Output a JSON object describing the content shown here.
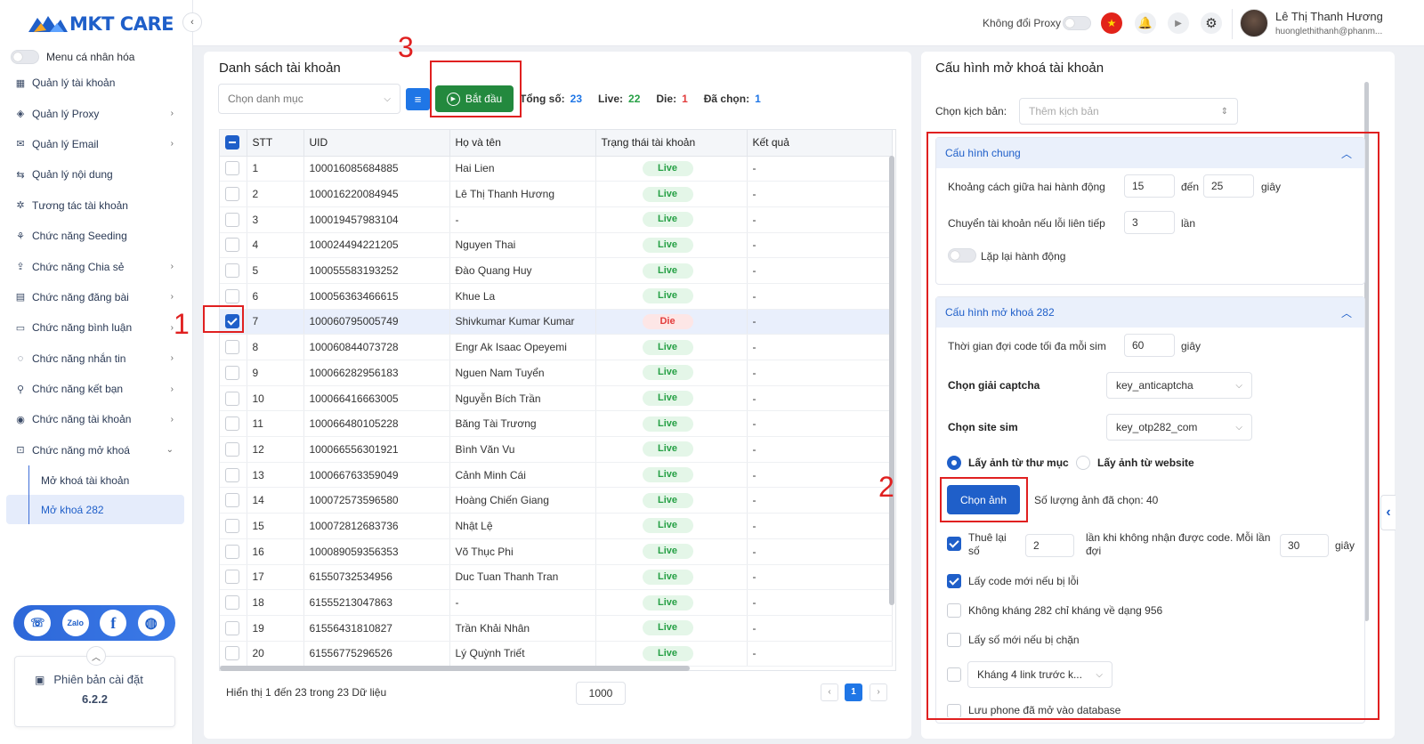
{
  "app": {
    "logo_text": "MKT CARE",
    "accent": "#1f5fc9",
    "live_color": "#26a045",
    "die_color": "#e23c3c"
  },
  "sidebar": {
    "toggle_label": "Menu cá nhân hóa",
    "items": [
      {
        "label": "Quản lý tài khoản",
        "icon": "grid-icon",
        "has_children": false
      },
      {
        "label": "Quản lý Proxy",
        "icon": "layers-icon",
        "has_children": true
      },
      {
        "label": "Quản lý Email",
        "icon": "mail-icon",
        "has_children": true
      },
      {
        "label": "Quản lý nội dung",
        "icon": "content-icon",
        "has_children": false
      },
      {
        "label": "Tương tác tài khoản",
        "icon": "interact-icon",
        "has_children": false
      },
      {
        "label": "Chức năng Seeding",
        "icon": "seeding-icon",
        "has_children": false
      },
      {
        "label": "Chức năng Chia sẻ",
        "icon": "share-icon",
        "has_children": true
      },
      {
        "label": "Chức năng đăng bài",
        "icon": "post-icon",
        "has_children": true
      },
      {
        "label": "Chức năng bình luận",
        "icon": "comment-icon",
        "has_children": true
      },
      {
        "label": "Chức năng nhắn tin",
        "icon": "message-icon",
        "has_children": true
      },
      {
        "label": "Chức năng kết bạn",
        "icon": "add-friend-icon",
        "has_children": true
      },
      {
        "label": "Chức năng tài khoản",
        "icon": "account-icon",
        "has_children": true
      },
      {
        "label": "Chức năng mở khoá",
        "icon": "unlock-icon",
        "has_children": true,
        "expanded": true
      }
    ],
    "subitems": [
      {
        "label": "Mở khoá tài khoản",
        "active": false
      },
      {
        "label": "Mở khoá 282",
        "active": true
      }
    ],
    "version_label": "Phiên bản cài đặt",
    "version": "6.2.2"
  },
  "topbar": {
    "proxy_label": "Không đổi Proxy",
    "user_name": "Lê Thị Thanh Hương",
    "user_email": "huonglethithanh@phanm..."
  },
  "accounts": {
    "title": "Danh sách tài khoản",
    "category_placeholder": "Chọn danh mục",
    "start_label": "Bắt đầu",
    "stats": {
      "total_label": "Tổng số:",
      "total": "23",
      "live_label": "Live:",
      "live": "22",
      "die_label": "Die:",
      "die": "1",
      "selected_label": "Đã chọn:",
      "selected": "1"
    },
    "columns": [
      "STT",
      "UID",
      "Họ và tên",
      "Trạng thái tài khoản",
      "Kết quả"
    ],
    "rows": [
      {
        "stt": "1",
        "uid": "100016085684885",
        "name": "Hai Lien",
        "status": "Live",
        "result": "-",
        "checked": false
      },
      {
        "stt": "2",
        "uid": "100016220084945",
        "name": "Lê Thị Thanh Hương",
        "status": "Live",
        "result": "-",
        "checked": false
      },
      {
        "stt": "3",
        "uid": "100019457983104",
        "name": "-",
        "status": "Live",
        "result": "-",
        "checked": false
      },
      {
        "stt": "4",
        "uid": "100024494221205",
        "name": "Nguyen Thai",
        "status": "Live",
        "result": "-",
        "checked": false
      },
      {
        "stt": "5",
        "uid": "100055583193252",
        "name": "Đào Quang Huy",
        "status": "Live",
        "result": "-",
        "checked": false
      },
      {
        "stt": "6",
        "uid": "100056363466615",
        "name": "Khue La",
        "status": "Live",
        "result": "-",
        "checked": false
      },
      {
        "stt": "7",
        "uid": "100060795005749",
        "name": "Shivkumar Kumar Kumar",
        "status": "Die",
        "result": "-",
        "checked": true
      },
      {
        "stt": "8",
        "uid": "100060844073728",
        "name": "Engr Ak Isaac Opeyemi",
        "status": "Live",
        "result": "-",
        "checked": false
      },
      {
        "stt": "9",
        "uid": "100066282956183",
        "name": "Nguen Nam Tuyển",
        "status": "Live",
        "result": "-",
        "checked": false
      },
      {
        "stt": "10",
        "uid": "100066416663005",
        "name": "Nguyễn Bích Trần",
        "status": "Live",
        "result": "-",
        "checked": false
      },
      {
        "stt": "11",
        "uid": "100066480105228",
        "name": "Băng Tài Trương",
        "status": "Live",
        "result": "-",
        "checked": false
      },
      {
        "stt": "12",
        "uid": "100066556301921",
        "name": "Bình Văn Vu",
        "status": "Live",
        "result": "-",
        "checked": false
      },
      {
        "stt": "13",
        "uid": "100066763359049",
        "name": "Cảnh Minh Cái",
        "status": "Live",
        "result": "-",
        "checked": false
      },
      {
        "stt": "14",
        "uid": "100072573596580",
        "name": "Hoàng Chiến Giang",
        "status": "Live",
        "result": "-",
        "checked": false
      },
      {
        "stt": "15",
        "uid": "100072812683736",
        "name": "Nhật Lệ",
        "status": "Live",
        "result": "-",
        "checked": false
      },
      {
        "stt": "16",
        "uid": "100089059356353",
        "name": "Võ Thục Phi",
        "status": "Live",
        "result": "-",
        "checked": false
      },
      {
        "stt": "17",
        "uid": "61550732534956",
        "name": "Duc Tuan Thanh Tran",
        "status": "Live",
        "result": "-",
        "checked": false
      },
      {
        "stt": "18",
        "uid": "61555213047863",
        "name": "-",
        "status": "Live",
        "result": "-",
        "checked": false
      },
      {
        "stt": "19",
        "uid": "61556431810827",
        "name": "Trần Khải Nhân",
        "status": "Live",
        "result": "-",
        "checked": false
      },
      {
        "stt": "20",
        "uid": "61556775296526",
        "name": "Lý Quỳnh Triết",
        "status": "Live",
        "result": "-",
        "checked": false
      }
    ],
    "footer_info": "Hiển thị 1 đến 23 trong 23 Dữ liệu",
    "page_size": "1000",
    "current_page": "1"
  },
  "config": {
    "title": "Cấu hình mở khoá tài khoản",
    "script_label": "Chọn kịch bản:",
    "script_placeholder": "Thêm kịch bản",
    "general": {
      "title": "Cấu hình chung",
      "delay_label": "Khoảng cách giữa hai hành động",
      "delay_from": "15",
      "to_label": "đến",
      "delay_to": "25",
      "sec_label": "giây",
      "switch_label": "Chuyển tài khoản nếu lỗi liên tiếp",
      "switch_value": "3",
      "times_label": "lần",
      "repeat_label": "Lặp lại hành động"
    },
    "unlock": {
      "title": "Cấu hình mở khoá 282",
      "wait_label": "Thời gian đợi code tối đa mỗi sim",
      "wait_value": "60",
      "wait_unit": "giây",
      "captcha_label": "Chọn giải captcha",
      "captcha_value": "key_anticaptcha",
      "sim_label": "Chọn site sim",
      "sim_value": "key_otp282_com",
      "radio_folder": "Lấy ảnh từ thư mục",
      "radio_web": "Lấy ảnh từ website",
      "choose_btn": "Chọn ảnh",
      "photo_count": "Số lượng ảnh đã chọn: 40",
      "rent_label": "Thuê lại số",
      "rent_value": "2",
      "rent_text": "lần khi không nhận được code. Mỗi lần đợi",
      "rent_wait": "30",
      "rent_unit": "giây",
      "new_code_label": "Lấy code mới nếu bị lỗi",
      "no_956_label": "Không kháng 282 chỉ kháng về dạng 956",
      "new_number_label": "Lấy số mới nếu bị chặn",
      "link_select": "Kháng 4 link trước k...",
      "save_phone_label": "Lưu phone đã mở vào database"
    }
  },
  "annotations": {
    "one": "1",
    "two": "2",
    "three": "3"
  }
}
